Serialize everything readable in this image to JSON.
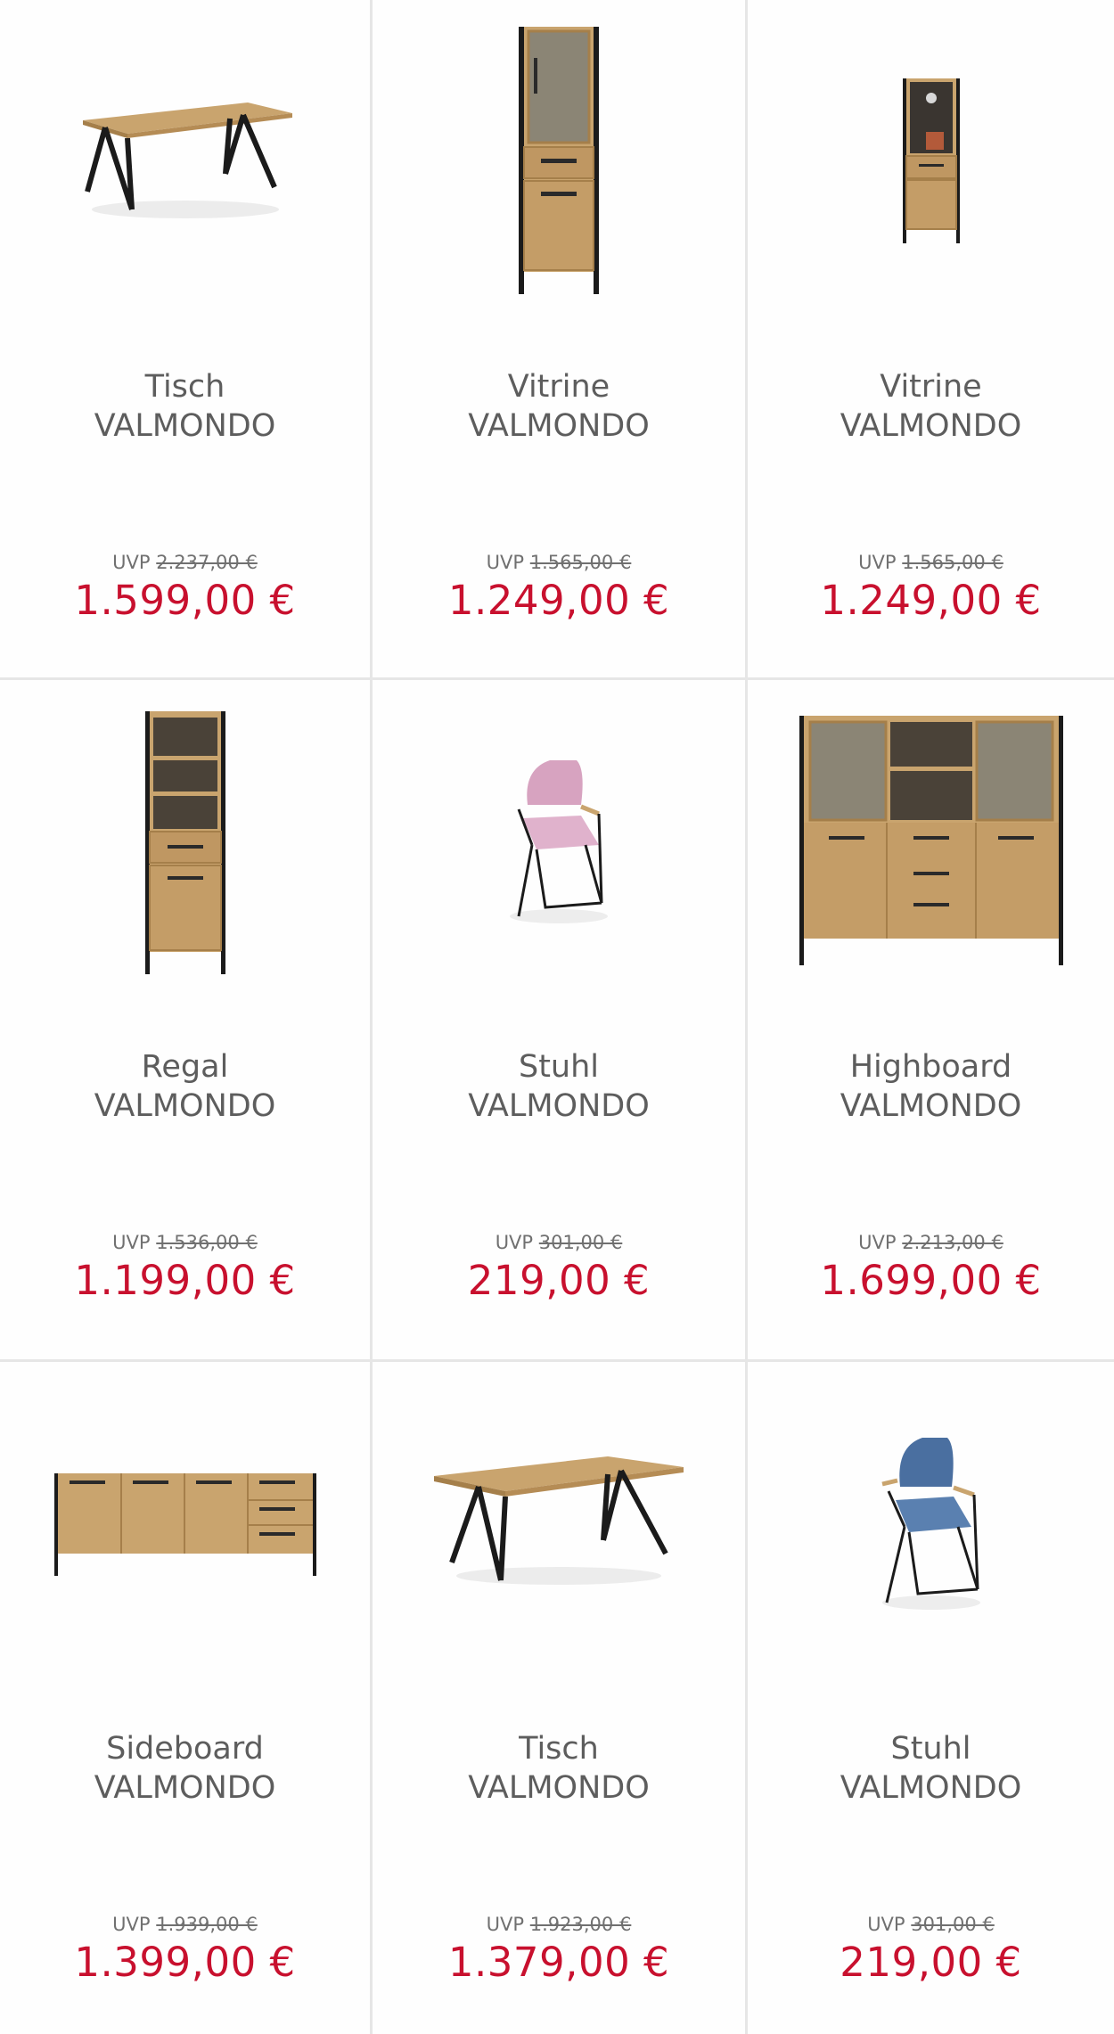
{
  "products": [
    {
      "type": "Tisch",
      "brand": "VALMONDO",
      "uvp_label": "UVP",
      "uvp_price": "2.237,00 €",
      "price": "1.599,00 €",
      "image": "dining-table-icon"
    },
    {
      "type": "Vitrine",
      "brand": "VALMONDO",
      "uvp_label": "UVP",
      "uvp_price": "1.565,00 €",
      "price": "1.249,00 €",
      "image": "tall-vitrine-icon"
    },
    {
      "type": "Vitrine",
      "brand": "VALMONDO",
      "uvp_label": "UVP",
      "uvp_price": "1.565,00 €",
      "price": "1.249,00 €",
      "image": "small-vitrine-icon"
    },
    {
      "type": "Regal",
      "brand": "VALMONDO",
      "uvp_label": "UVP",
      "uvp_price": "1.536,00 €",
      "price": "1.199,00 €",
      "image": "shelf-icon"
    },
    {
      "type": "Stuhl",
      "brand": "VALMONDO",
      "uvp_label": "UVP",
      "uvp_price": "301,00 €",
      "price": "219,00 €",
      "image": "pink-chair-icon"
    },
    {
      "type": "Highboard",
      "brand": "VALMONDO",
      "uvp_label": "UVP",
      "uvp_price": "2.213,00 €",
      "price": "1.699,00 €",
      "image": "highboard-icon"
    },
    {
      "type": "Sideboard",
      "brand": "VALMONDO",
      "uvp_label": "UVP",
      "uvp_price": "1.939,00 €",
      "price": "1.399,00 €",
      "image": "sideboard-icon"
    },
    {
      "type": "Tisch",
      "brand": "VALMONDO",
      "uvp_label": "UVP",
      "uvp_price": "1.923,00 €",
      "price": "1.379,00 €",
      "image": "dining-table-icon"
    },
    {
      "type": "Stuhl",
      "brand": "VALMONDO",
      "uvp_label": "UVP",
      "uvp_price": "301,00 €",
      "price": "219,00 €",
      "image": "blue-chair-icon"
    }
  ],
  "colors": {
    "price": "#c8102e",
    "title": "#5d5d5d",
    "divider": "#e6e6e6",
    "oak": "#c9a46e",
    "metal": "#1b1b1b",
    "pink_fabric": "#d7a3c0",
    "blue_fabric": "#4a6fa0"
  }
}
